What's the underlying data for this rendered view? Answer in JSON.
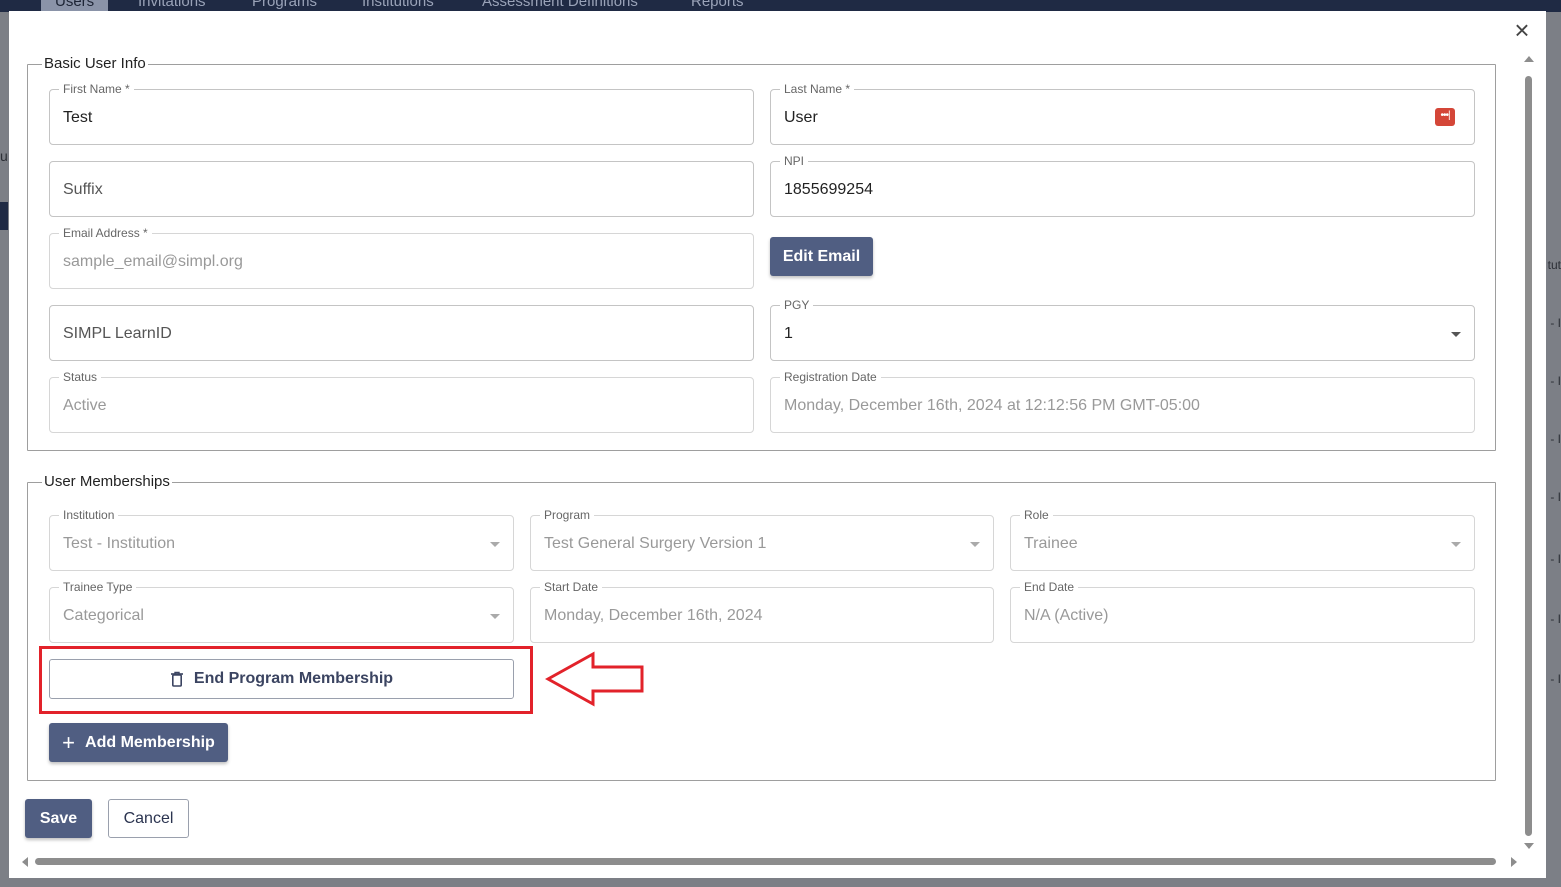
{
  "background": {
    "nav_tabs": [
      "Users",
      "Invitations",
      "Programs",
      "Institutions",
      "Assessment Definitions",
      "Reports"
    ],
    "right_texts": [
      "tut",
      "- I",
      "- I",
      "- I",
      "- I",
      "- I",
      "- I",
      "- I"
    ],
    "left_text": "u"
  },
  "modal": {
    "close_label": "×",
    "basic_info": {
      "legend": "Basic User Info",
      "first_name": {
        "label": "First Name *",
        "value": "Test"
      },
      "last_name": {
        "label": "Last Name *",
        "value": "User"
      },
      "suffix": {
        "placeholder": "Suffix"
      },
      "npi": {
        "label": "NPI",
        "value": "1855699254"
      },
      "email": {
        "label": "Email Address *",
        "value": "sample_email@simpl.org"
      },
      "edit_email_label": "Edit Email",
      "learn_id": {
        "placeholder": "SIMPL LearnID"
      },
      "pgy": {
        "label": "PGY",
        "value": "1"
      },
      "status": {
        "label": "Status",
        "value": "Active"
      },
      "registration_date": {
        "label": "Registration Date",
        "value": "Monday, December 16th, 2024 at 12:12:56 PM GMT-05:00"
      }
    },
    "memberships": {
      "legend": "User Memberships",
      "institution": {
        "label": "Institution",
        "value": "Test - Institution"
      },
      "program": {
        "label": "Program",
        "value": "Test General Surgery Version 1"
      },
      "role": {
        "label": "Role",
        "value": "Trainee"
      },
      "trainee_type": {
        "label": "Trainee Type",
        "value": "Categorical"
      },
      "start_date": {
        "label": "Start Date",
        "value": "Monday, December 16th, 2024"
      },
      "end_date": {
        "label": "End Date",
        "value": "N/A (Active)"
      },
      "end_membership_label": "End Program Membership",
      "add_membership_label": "Add Membership"
    },
    "save_label": "Save",
    "cancel_label": "Cancel"
  },
  "colors": {
    "primary": "#505e82",
    "highlight": "#e2222a",
    "nav": "#1f2a44"
  }
}
